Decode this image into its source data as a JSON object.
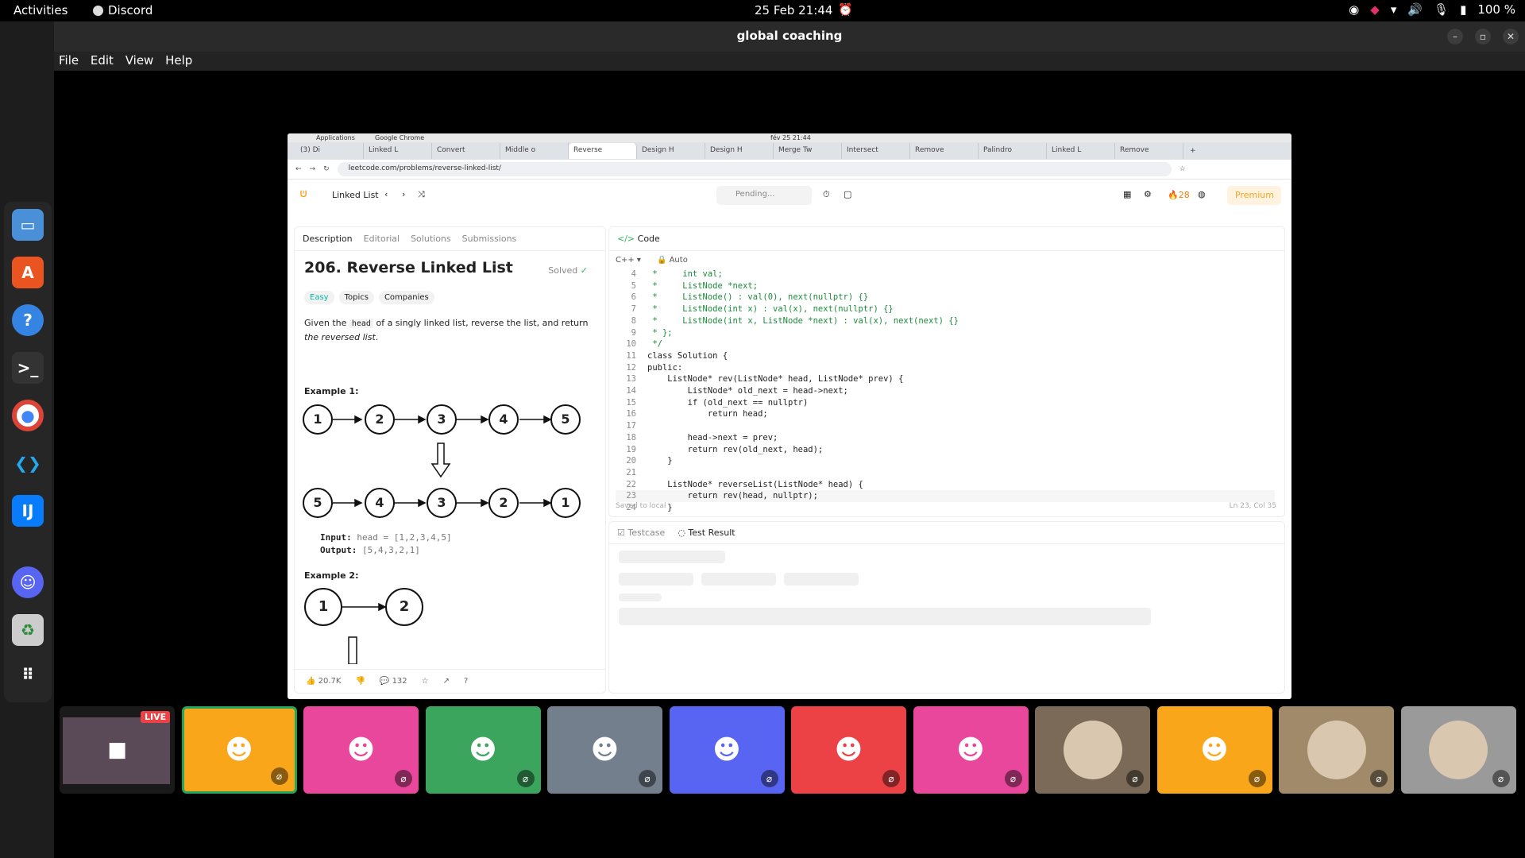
{
  "topbar": {
    "activities": "Activities",
    "app": "Discord",
    "clock": "25 Feb  21:44",
    "battery": "100 %"
  },
  "window": {
    "title": "global coaching"
  },
  "menu": [
    "File",
    "Edit",
    "View",
    "Help"
  ],
  "share": {
    "os": {
      "apps": "Applications",
      "browser": "Google Chrome",
      "clock": "fév 25  21:44"
    },
    "tabs": [
      "(3) Di",
      "Linked L",
      "Convert",
      "Middle o",
      "Reverse",
      "Design H",
      "Design H",
      "Merge Tw",
      "Intersect",
      "Remove",
      "Palindro",
      "Linked L",
      "Remove"
    ],
    "url": "leetcode.com/problems/reverse-linked-list/",
    "lc": {
      "list": "Linked List",
      "pending": "Pending...",
      "streak": "28",
      "premium": "Premium"
    },
    "left": {
      "tabs": [
        "Description",
        "Editorial",
        "Solutions",
        "Submissions"
      ],
      "title": "206. Reverse Linked List",
      "solved": "Solved",
      "pills": [
        "Easy",
        "Topics",
        "Companies"
      ],
      "desc_pre": "Given the ",
      "desc_code": "head",
      "desc_mid": " of a singly linked list, reverse the list, and return ",
      "desc_em": "the reversed list",
      "desc_end": ".",
      "ex1": "Example 1:",
      "list1": [
        "1",
        "2",
        "3",
        "4",
        "5"
      ],
      "list2": [
        "5",
        "4",
        "3",
        "2",
        "1"
      ],
      "in_label": "Input:",
      "in_val": "head = [1,2,3,4,5]",
      "out_label": "Output:",
      "out_val": "[5,4,3,2,1]",
      "ex2": "Example 2:",
      "list3": [
        "1",
        "2"
      ],
      "likes": "20.7K",
      "comments": "132"
    },
    "right": {
      "header": "Code",
      "lang": "C++",
      "mode": "Auto",
      "lines": [
        [
          "4",
          " *     int val;"
        ],
        [
          "5",
          " *     ListNode *next;"
        ],
        [
          "6",
          " *     ListNode() : val(0), next(nullptr) {}"
        ],
        [
          "7",
          " *     ListNode(int x) : val(x), next(nullptr) {}"
        ],
        [
          "8",
          " *     ListNode(int x, ListNode *next) : val(x), next(next) {}"
        ],
        [
          "9",
          " * };"
        ],
        [
          "10",
          " */"
        ],
        [
          "11",
          "class Solution {"
        ],
        [
          "12",
          "public:"
        ],
        [
          "13",
          "    ListNode* rev(ListNode* head, ListNode* prev) {"
        ],
        [
          "14",
          "        ListNode* old_next = head->next;"
        ],
        [
          "15",
          "        if (old_next == nullptr)"
        ],
        [
          "16",
          "            return head;"
        ],
        [
          "17",
          ""
        ],
        [
          "18",
          "        head->next = prev;"
        ],
        [
          "19",
          "        return rev(old_next, head);"
        ],
        [
          "20",
          "    }"
        ],
        [
          "21",
          ""
        ],
        [
          "22",
          "    ListNode* reverseList(ListNode* head) {"
        ],
        [
          "23",
          "        return rev(head, nullptr);"
        ],
        [
          "24",
          "    }"
        ]
      ],
      "saved": "Saved to local",
      "position": "Ln 23, Col 35"
    },
    "bottom": {
      "tabs": [
        "Testcase",
        "Test Result"
      ]
    }
  },
  "participants": [
    {
      "kind": "screen",
      "live": "LIVE"
    },
    {
      "color": "#f9a61a",
      "selected": true
    },
    {
      "color": "#e8479b"
    },
    {
      "color": "#3ba55d"
    },
    {
      "color": "#747f8d"
    },
    {
      "color": "#5865f2"
    },
    {
      "color": "#ed4245"
    },
    {
      "color": "#e8479b"
    },
    {
      "kind": "photo",
      "color": "#7b6a57"
    },
    {
      "color": "#f9a61a"
    },
    {
      "kind": "photo",
      "color": "#a08a6a"
    },
    {
      "kind": "photo",
      "color": "#9a9a9a"
    }
  ]
}
